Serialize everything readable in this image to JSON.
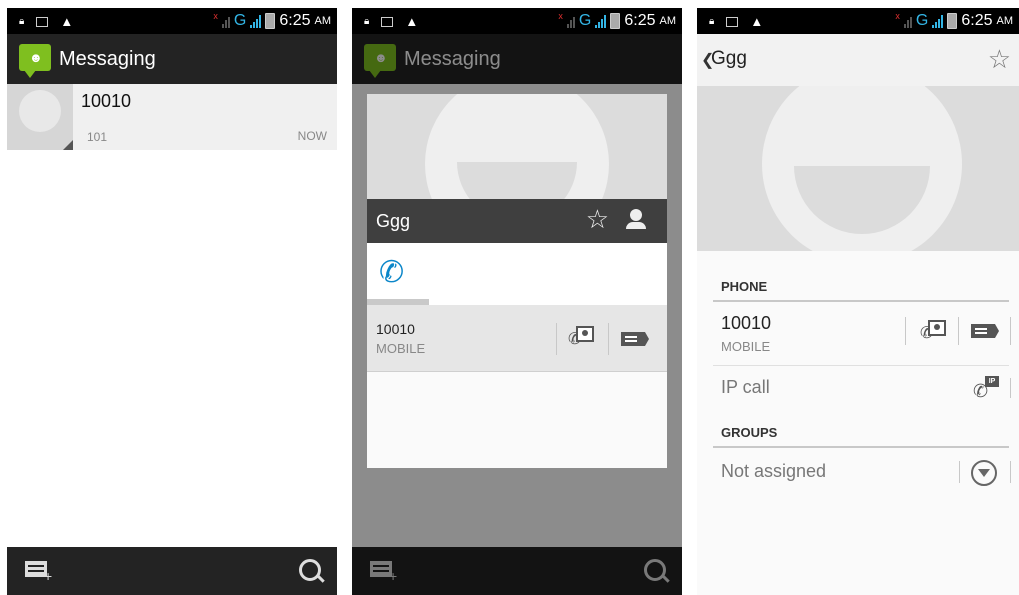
{
  "status_bar": {
    "time": "6:25",
    "ampm": "AM",
    "network": "G"
  },
  "screen1": {
    "app_title": "Messaging",
    "conversation": {
      "name": "10010",
      "snippet": "101",
      "time": "NOW"
    }
  },
  "screen2": {
    "app_title": "Messaging",
    "contact_name": "Ggg",
    "number": "10010",
    "number_type": "MOBILE"
  },
  "screen3": {
    "title": "Ggg",
    "phone_section": "PHONE",
    "number": "10010",
    "number_type": "MOBILE",
    "ip_call": "IP call",
    "groups_section": "GROUPS",
    "groups_value": "Not assigned"
  },
  "colors": {
    "accent": "#33b5e5",
    "messaging_logo": "#7fbf1f",
    "call_blue": "#0b86c9",
    "signal_error": "#e03030"
  }
}
